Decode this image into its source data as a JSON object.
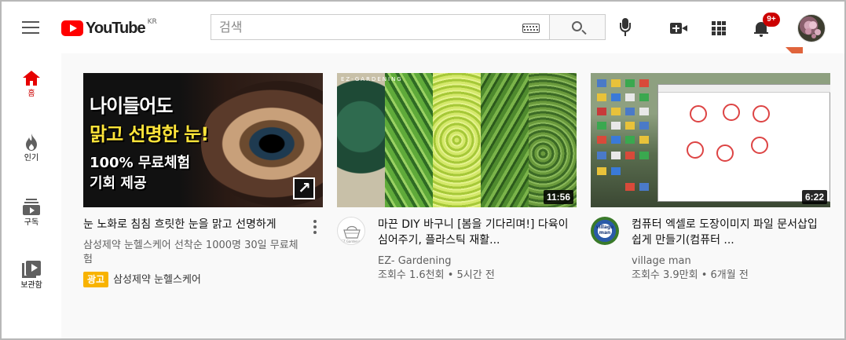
{
  "header": {
    "logo_text": "YouTube",
    "logo_region": "KR",
    "search_placeholder": "검색",
    "notification_count": "9+"
  },
  "sidebar": {
    "items": [
      {
        "label": "홈",
        "icon": "home-icon",
        "active": true
      },
      {
        "label": "인기",
        "icon": "fire-icon"
      },
      {
        "label": "구독",
        "icon": "subscriptions-icon"
      },
      {
        "label": "보관함",
        "icon": "library-icon"
      }
    ]
  },
  "videos": [
    {
      "title": "눈 노화로 침침 흐릿한 눈을 맑고 선명하게",
      "channel": "삼성제약 눈헬스케어 선착순 1000명 30일 무료체험",
      "ad_label": "광고",
      "advertiser": "삼성제약 눈헬스케어",
      "thumb_lines": [
        "나이들어도",
        "맑고 선명한 눈!",
        "100% 무료체험",
        "기회 제공"
      ]
    },
    {
      "title": "마끈 DIY 바구니 [봄을 기다리며!] 다육이 심어주기, 플라스틱 재활...",
      "channel": "EZ- Gardening",
      "stats": "조회수 1.6천회 • 5시간 전",
      "duration": "11:56",
      "thumb_brand": "EZ-GARDENING",
      "avatar_text": "EZ Gardening"
    },
    {
      "title": "컴퓨터 엑셀로 도장이미지 파일 문서삽입 쉽게 만들기(컴퓨터 ...",
      "channel": "village man",
      "stats": "조회수 3.9만회 • 6개월 전",
      "duration": "6:22",
      "avatar_text": "village man"
    }
  ],
  "colors": {
    "brand_red": "#ff0000",
    "ad_yellow": "#f8b300",
    "arrow_orange": "#e0643c"
  }
}
